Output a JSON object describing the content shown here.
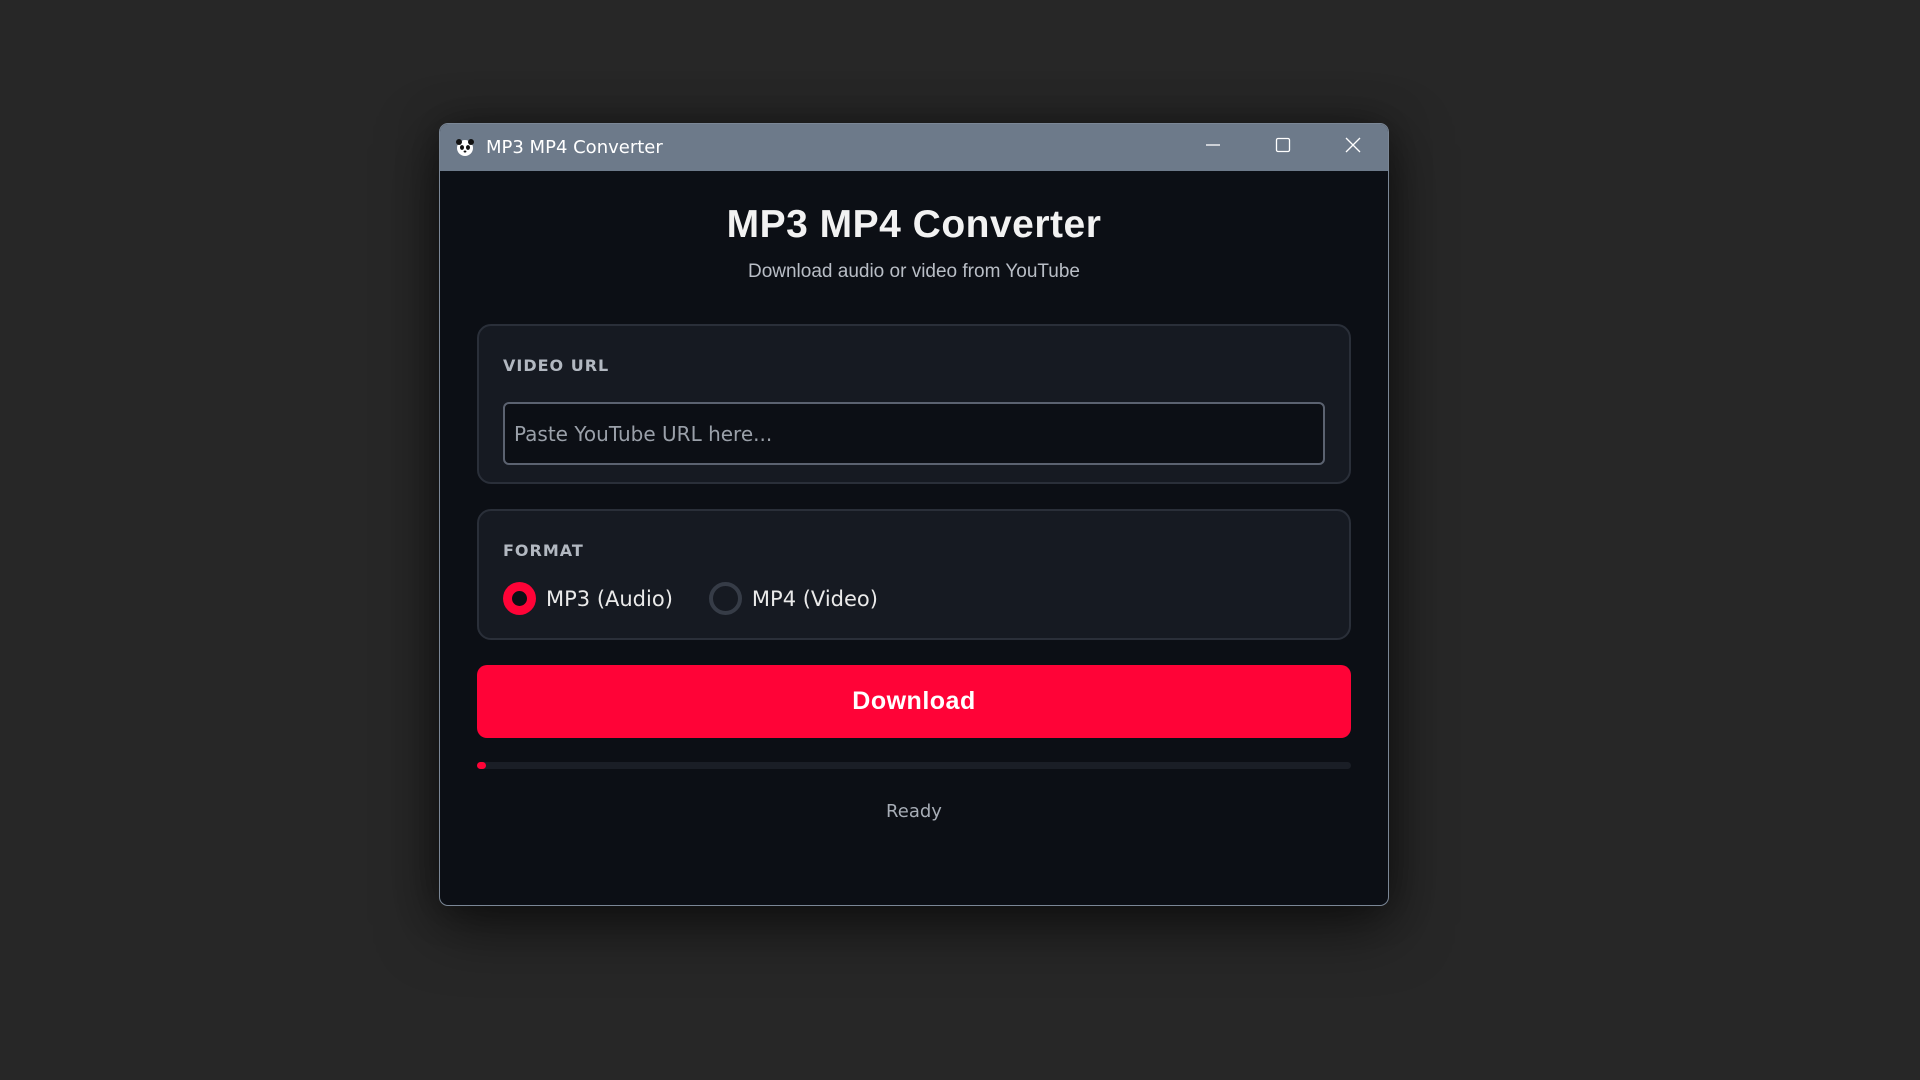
{
  "window": {
    "title": "MP3 MP4 Converter",
    "icon": "panda-logo-icon"
  },
  "header": {
    "title": "MP3 MP4 Converter",
    "subtitle": "Download audio or video from YouTube"
  },
  "url_section": {
    "label": "VIDEO URL",
    "value": "",
    "placeholder": "Paste YouTube URL here..."
  },
  "format_section": {
    "label": "FORMAT",
    "options": [
      {
        "label": "MP3 (Audio)",
        "selected": true
      },
      {
        "label": "MP4 (Video)",
        "selected": false
      }
    ]
  },
  "download_button": {
    "label": "Download"
  },
  "progress": {
    "value": 0
  },
  "status": {
    "text": "Ready"
  },
  "colors": {
    "accent": "#ff0337",
    "background": "#0c0f15",
    "card": "#161a22",
    "titlebar": "#6d7a8a"
  }
}
